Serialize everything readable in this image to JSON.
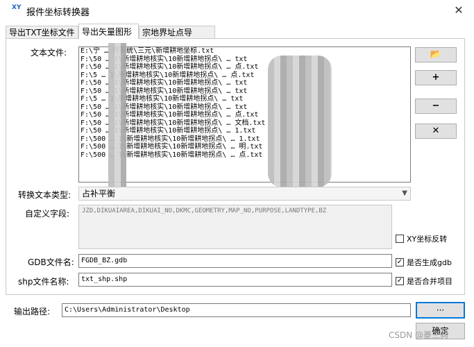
{
  "window": {
    "title": "报件坐标转换器",
    "app_icon_text": "XY",
    "close_glyph": "✕"
  },
  "tabs": [
    {
      "label": "导出TXT坐标文件"
    },
    {
      "label": "导出矢量图形"
    },
    {
      "label": "宗地界址点导Excel"
    }
  ],
  "form": {
    "text_files_label": "文本文件:",
    "file_list": [
      "E:\\宁 … 传系统\\三元\\新增耕地坐标.txt",
      "F:\\50 … 1\\新增耕地核实\\10新增耕地拐点\\ … txt",
      "F:\\50 … 1\\新增耕地核实\\10新增耕地拐点\\ … 点.txt",
      "F:\\5 … 1\\新增耕地核实\\10新增耕地拐点\\ … 点.txt",
      "F:\\50 … 1\\新增耕地核实\\10新增耕地拐点\\ … txt",
      "F:\\50 … 1\\新增耕地核实\\10新增耕地拐点\\ … txt",
      "F:\\5 … 1\\新增耕地核实\\10新增耕地拐点\\ … txt",
      "F:\\50 … 1\\新增耕地核实\\10新增耕地拐点\\ … txt",
      "F:\\50 … 1\\新增耕地核实\\10新增耕地拐点\\ … 点.txt",
      "F:\\50 … 1\\新增耕地核实\\10新增耕地拐点\\ … 文档.txt",
      "F:\\50 … 1\\新增耕地核实\\10新增耕地拐点\\ … 1.txt",
      "F:\\500 … 1\\新增耕地核实\\10新增耕地拐点\\ … 1.txt",
      "F:\\500 … 1\\新增耕地核实\\10新增耕地拐点\\ … 明.txt",
      "F:\\500 … 1\\新增耕地核实\\10新增耕地拐点\\ … 点.txt"
    ],
    "convert_type_label": "转换文本类型:",
    "convert_type_value": "占补平衡",
    "custom_fields_label": "自定义字段:",
    "custom_fields_value": "JZD,DIKUAIAREA,DIKUAI_NO,DKMC,GEOMETRY,MAP_NO,PURPOSE,LANDTYPE,BZ",
    "xy_reverse_label": "XY坐标反转",
    "gdb_label": "GDB文件名:",
    "gdb_value": "FGDB_BZ.gdb",
    "gen_gdb_label": "是否生成gdb",
    "shp_label": "shp文件名称:",
    "shp_value": "txt_shp.shp",
    "merge_label": "是否合并项目"
  },
  "side_buttons": {
    "open_folder_icon": "📂",
    "add": "+",
    "remove": "−",
    "clear": "✕"
  },
  "footer": {
    "output_label": "输出路径:",
    "output_value": "C:\\Users\\Administrator\\Desktop",
    "browse_label": "···",
    "ok_label": "确定"
  },
  "checks": {
    "xy_reverse": false,
    "gen_gdb": true,
    "merge": true
  },
  "watermark": "CSDN @菱三狗"
}
